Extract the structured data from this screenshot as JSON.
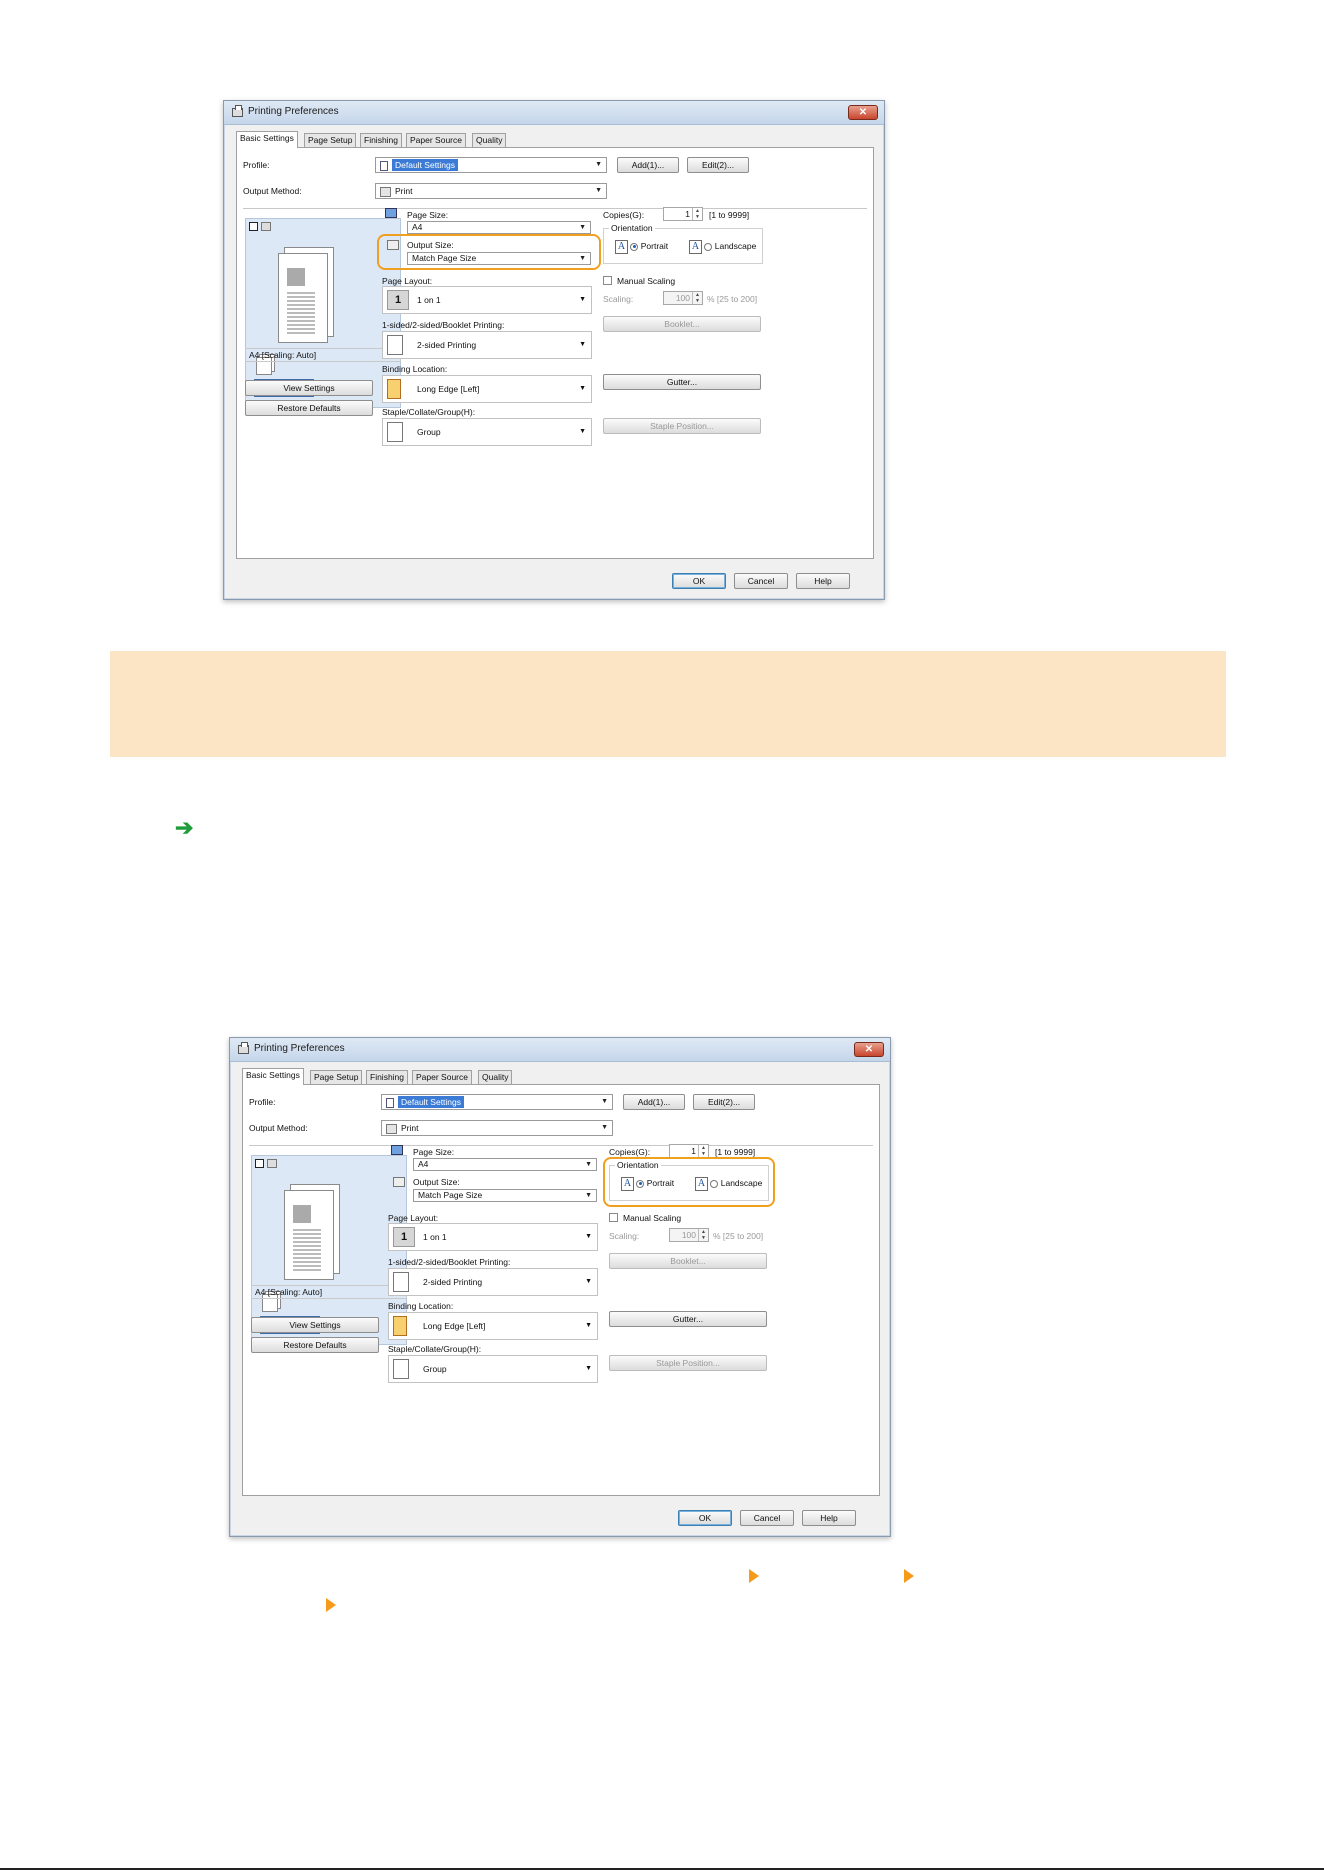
{
  "dialog": {
    "title": "Printing Preferences",
    "close_glyph": "✕",
    "tabs": [
      "Basic Settings",
      "Page Setup",
      "Finishing",
      "Paper Source",
      "Quality"
    ],
    "profile_label": "Profile:",
    "profile_value": "Default Settings",
    "add_button": "Add(1)...",
    "edit_button": "Edit(2)...",
    "output_method_label": "Output Method:",
    "output_method_value": "Print",
    "preview_caption": "A4 [Scaling: Auto]",
    "view_settings_button": "View Settings",
    "restore_defaults_button": "Restore Defaults",
    "page_size_label": "Page Size:",
    "page_size_value": "A4",
    "output_size_label": "Output Size:",
    "output_size_value": "Match Page Size",
    "page_layout_label": "Page Layout:",
    "page_layout_value": "1 on 1",
    "page_layout_icon_text": "1",
    "sided_label": "1-sided/2-sided/Booklet Printing:",
    "sided_value": "2-sided Printing",
    "binding_label": "Binding Location:",
    "binding_value": "Long Edge [Left]",
    "staple_label": "Staple/Collate/Group(H):",
    "staple_value": "Group",
    "copies_label": "Copies(G):",
    "copies_value": "1",
    "copies_range": "[1 to 9999]",
    "orientation_label": "Orientation",
    "orientation_icon": "A",
    "portrait_label": "Portrait",
    "landscape_label": "Landscape",
    "manual_scaling_label": "Manual Scaling",
    "scaling_label": "Scaling:",
    "scaling_value": "100",
    "scaling_range": "% [25 to 200]",
    "booklet_button": "Booklet...",
    "gutter_button": "Gutter...",
    "staple_position_button": "Staple Position...",
    "ok_button": "OK",
    "cancel_button": "Cancel",
    "help_button": "Help"
  },
  "colors": {
    "highlight": "#f0a020",
    "note_band": "#fbe5c5",
    "arrow_green": "#1f9d3a",
    "breadcrumb_triangle": "#f59a1b"
  },
  "icons": {
    "step_arrow": "➔"
  }
}
